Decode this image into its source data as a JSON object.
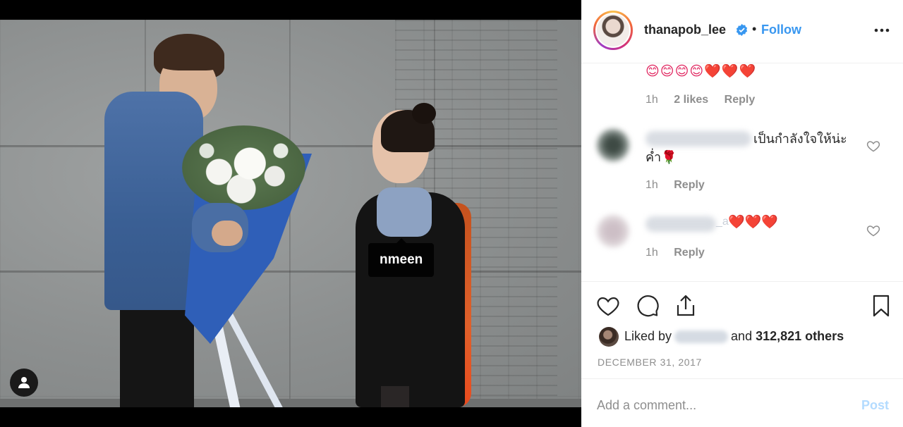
{
  "photo": {
    "tag_label": "nmeen",
    "user_tag_icon": "person-icon"
  },
  "header": {
    "username": "thanapob_lee",
    "verified_icon": "verified-badge-icon",
    "separator": "•",
    "follow_label": "Follow",
    "more_icon": "ellipsis-icon"
  },
  "comments": [
    {
      "text": "😊😊😊😊❤️❤️❤️",
      "time": "1h",
      "likes": "2 likes",
      "reply_label": "Reply"
    },
    {
      "text": "เป็นกำลังใจให้น่ะค่ำ🌹",
      "time": "1h",
      "reply_label": "Reply"
    },
    {
      "text": "❤️❤️❤️",
      "name_suffix": "_a",
      "time": "1h",
      "reply_label": "Reply"
    }
  ],
  "actions": {
    "like_icon": "heart-icon",
    "comment_icon": "comment-bubble-icon",
    "share_icon": "share-icon",
    "save_icon": "bookmark-icon"
  },
  "likes": {
    "prefix": "Liked by",
    "connector": "and",
    "count": "312,821 others"
  },
  "date": "DECEMBER 31, 2017",
  "add_comment": {
    "placeholder": "Add a comment...",
    "post_label": "Post"
  },
  "colors": {
    "accent": "#3897f0",
    "post_disabled": "#b3dbff",
    "meta_gray": "#8e8e8e",
    "heart_red": "#e0245e"
  }
}
